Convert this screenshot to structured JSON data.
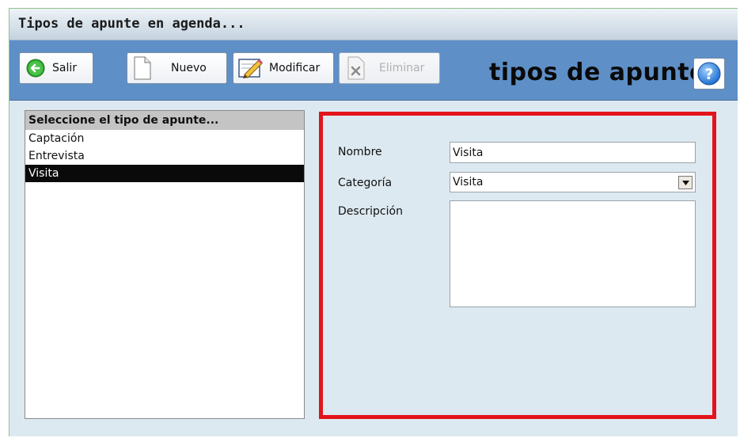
{
  "window": {
    "title": "Tipos de apunte en agenda..."
  },
  "toolbar": {
    "exit_label": "Salir",
    "new_label": "Nuevo",
    "modify_label": "Modificar",
    "delete_label": "Eliminar",
    "heading": "tipos de apunte",
    "help_icon": "help-icon"
  },
  "list": {
    "header": "Seleccione el tipo de apunte...",
    "items": [
      "Captación",
      "Entrevista",
      "Visita"
    ],
    "selected": "Visita"
  },
  "form": {
    "name_label": "Nombre",
    "name_value": "Visita",
    "category_label": "Categoría",
    "category_value": "Visita",
    "description_label": "Descripción",
    "description_value": ""
  },
  "colors": {
    "toolbar": "#5e8fc7",
    "panel_border": "#e3141b",
    "selection": "#0a0a0a"
  }
}
